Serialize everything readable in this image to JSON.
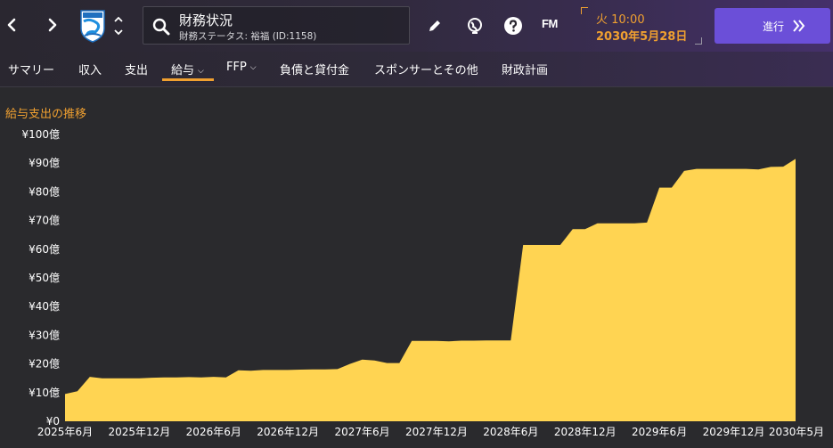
{
  "header": {
    "title": "財務状況",
    "subtitle": "財務ステータス: 裕福 (ID:1158)",
    "fm_logo": "FM",
    "time": "火 10:00",
    "date": "2030年5月28日",
    "continue_label": "進行",
    "icons": {
      "back": "chevron-left-icon",
      "forward": "chevron-right-icon",
      "search": "search-icon",
      "edit": "pencil-icon",
      "globe": "globe-icon",
      "help": "help-icon"
    },
    "accent_color": "#f0a030",
    "continue_color": "#6b4fd8"
  },
  "tabs": [
    {
      "label": "サマリー",
      "active": false
    },
    {
      "label": "収入",
      "active": false
    },
    {
      "label": "支出",
      "active": false
    },
    {
      "label": "給与",
      "active": true
    },
    {
      "label": "FFP",
      "active": false
    },
    {
      "label": "負債と貸付金",
      "active": false
    },
    {
      "label": "スポンサーとその他",
      "active": false
    },
    {
      "label": "財政計画",
      "active": false
    }
  ],
  "chart_data": {
    "type": "area",
    "title": "給与支出の推移",
    "ylim": [
      0,
      100
    ],
    "y_ticks": [
      "¥0",
      "¥10億",
      "¥20億",
      "¥30億",
      "¥40億",
      "¥50億",
      "¥60億",
      "¥70億",
      "¥80億",
      "¥90億",
      "¥100億"
    ],
    "x_range": [
      "2025-06",
      "2030-05"
    ],
    "x_ticks": [
      "2025年6月",
      "2025年12月",
      "2026年6月",
      "2026年12月",
      "2027年6月",
      "2027年12月",
      "2028年6月",
      "2028年12月",
      "2029年6月",
      "2029年12月",
      "2030年5月"
    ],
    "fill_color": "#ffd452",
    "grid": false,
    "series": [
      {
        "points": [
          [
            "2025-06",
            9.5
          ],
          [
            "2025-07",
            10.5
          ],
          [
            "2025-08",
            15.5
          ],
          [
            "2025-09",
            15
          ],
          [
            "2025-10",
            15
          ],
          [
            "2025-11",
            15
          ],
          [
            "2025-12",
            15
          ],
          [
            "2026-01",
            15.2
          ],
          [
            "2026-02",
            15.3
          ],
          [
            "2026-03",
            15.3
          ],
          [
            "2026-04",
            15.4
          ],
          [
            "2026-05",
            15.3
          ],
          [
            "2026-06",
            15.5
          ],
          [
            "2026-07",
            15.3
          ],
          [
            "2026-08",
            17.8
          ],
          [
            "2026-09",
            17.6
          ],
          [
            "2026-10",
            17.9
          ],
          [
            "2026-11",
            17.9
          ],
          [
            "2026-12",
            17.9
          ],
          [
            "2027-01",
            18
          ],
          [
            "2027-02",
            18.1
          ],
          [
            "2027-03",
            18.1
          ],
          [
            "2027-04",
            18.2
          ],
          [
            "2027-05",
            20
          ],
          [
            "2027-06",
            21.5
          ],
          [
            "2027-07",
            21.2
          ],
          [
            "2027-08",
            20.3
          ],
          [
            "2027-09",
            20.3
          ],
          [
            "2027-10",
            28
          ],
          [
            "2027-11",
            28
          ],
          [
            "2027-12",
            28
          ],
          [
            "2028-01",
            27.9
          ],
          [
            "2028-02",
            28.1
          ],
          [
            "2028-03",
            28.1
          ],
          [
            "2028-04",
            28.2
          ],
          [
            "2028-05",
            28.2
          ],
          [
            "2028-06",
            28.2
          ],
          [
            "2028-07",
            61.5
          ],
          [
            "2028-08",
            61.5
          ],
          [
            "2028-09",
            61.5
          ],
          [
            "2028-10",
            61.5
          ],
          [
            "2028-11",
            67
          ],
          [
            "2028-12",
            67
          ],
          [
            "2029-01",
            69
          ],
          [
            "2029-02",
            69
          ],
          [
            "2029-03",
            69
          ],
          [
            "2029-04",
            69
          ],
          [
            "2029-05",
            69.3
          ],
          [
            "2029-06",
            81.5
          ],
          [
            "2029-07",
            81.5
          ],
          [
            "2029-08",
            87.3
          ],
          [
            "2029-09",
            88
          ],
          [
            "2029-10",
            88
          ],
          [
            "2029-11",
            88
          ],
          [
            "2029-12",
            88
          ],
          [
            "2030-01",
            88
          ],
          [
            "2030-02",
            87.8
          ],
          [
            "2030-03",
            88.7
          ],
          [
            "2030-04",
            88.8
          ],
          [
            "2030-05",
            91.5
          ]
        ]
      }
    ]
  }
}
